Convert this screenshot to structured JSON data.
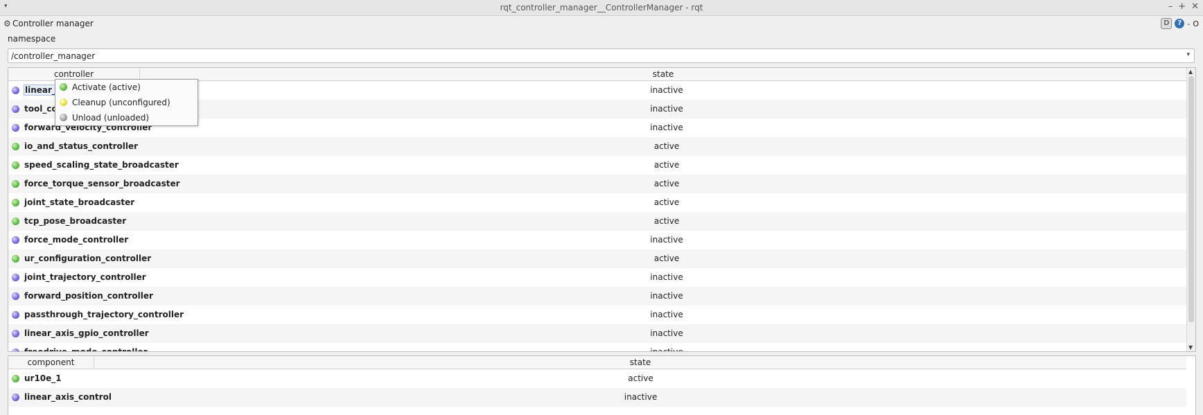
{
  "window": {
    "title": "rqt_controller_manager__ControllerManager - rqt",
    "minimize": "–",
    "maximize": "+",
    "close": "✕",
    "menu_glyph": "▾"
  },
  "plugin": {
    "title": "Controller manager",
    "icon": "gear-icon",
    "d_label": "D",
    "help_label": "?",
    "dash": "-",
    "o_label": "O"
  },
  "namespace": {
    "label": "namespace",
    "value": "/controller_manager",
    "arrow": "▾"
  },
  "controllers": {
    "columns": [
      "controller",
      "state"
    ],
    "rows": [
      {
        "name": "linear_ax",
        "state": "inactive",
        "led": "inactive"
      },
      {
        "name": "tool_con",
        "state": "inactive",
        "led": "inactive"
      },
      {
        "name": "forward_velocity_controller",
        "state": "inactive",
        "led": "inactive"
      },
      {
        "name": "io_and_status_controller",
        "state": "active",
        "led": "active"
      },
      {
        "name": "speed_scaling_state_broadcaster",
        "state": "active",
        "led": "active"
      },
      {
        "name": "force_torque_sensor_broadcaster",
        "state": "active",
        "led": "active"
      },
      {
        "name": "joint_state_broadcaster",
        "state": "active",
        "led": "active"
      },
      {
        "name": "tcp_pose_broadcaster",
        "state": "active",
        "led": "active"
      },
      {
        "name": "force_mode_controller",
        "state": "inactive",
        "led": "inactive"
      },
      {
        "name": "ur_configuration_controller",
        "state": "active",
        "led": "active"
      },
      {
        "name": "joint_trajectory_controller",
        "state": "inactive",
        "led": "inactive"
      },
      {
        "name": "forward_position_controller",
        "state": "inactive",
        "led": "inactive"
      },
      {
        "name": "passthrough_trajectory_controller",
        "state": "inactive",
        "led": "inactive"
      },
      {
        "name": "linear_axis_gpio_controller",
        "state": "inactive",
        "led": "inactive"
      },
      {
        "name": "freedrive_mode_controller",
        "state": "inactive",
        "led": "inactive"
      }
    ],
    "scroll_up": "▲",
    "scroll_down": "▼"
  },
  "context_menu": {
    "items": [
      {
        "label": "Activate (active)",
        "led": "active"
      },
      {
        "label": "Cleanup (unconfigured)",
        "led": "unconfigured"
      },
      {
        "label": "Unload (unloaded)",
        "led": "unloaded"
      }
    ]
  },
  "components": {
    "columns": [
      "component",
      "state"
    ],
    "rows": [
      {
        "name": "ur10e_1",
        "state": "active",
        "led": "active"
      },
      {
        "name": "linear_axis_control",
        "state": "inactive",
        "led": "inactive"
      }
    ]
  }
}
